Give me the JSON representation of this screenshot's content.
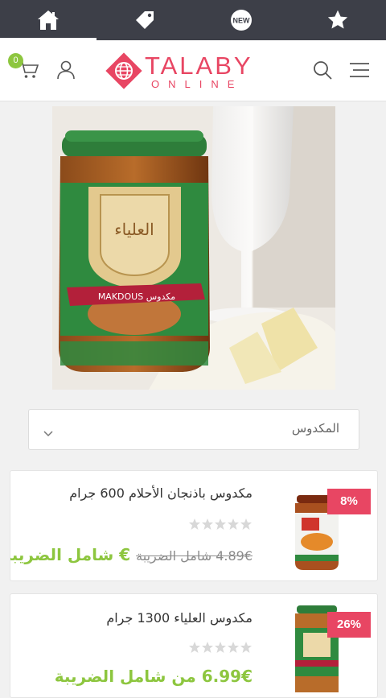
{
  "tabbar": {
    "tabs": [
      {
        "name": "home",
        "icon": "home-icon"
      },
      {
        "name": "offers",
        "icon": "tag-icon"
      },
      {
        "name": "new",
        "icon": "new-badge-icon",
        "label": "NEW"
      },
      {
        "name": "featured",
        "icon": "star-icon"
      }
    ]
  },
  "header": {
    "cart_count": "0",
    "logo": {
      "title": "TALABY",
      "subtitle": "ONLINE"
    }
  },
  "filter": {
    "selected": "المكدوس"
  },
  "products": [
    {
      "name": "مكدوس باذنجان الأحلام 600 جرام",
      "discount": "8%",
      "price_old": "4.89€ شامل الضريبة",
      "price_new": "€ شامل الضريبة",
      "rating": 0
    },
    {
      "name": "مكدوس العلياء 1300 جرام",
      "discount": "26%",
      "price_new": "6.99€ من شامل الضريبة",
      "rating": 0
    }
  ],
  "colors": {
    "accent": "#e84663",
    "price": "#8dc63f",
    "tabbar": "#3d3f48"
  }
}
